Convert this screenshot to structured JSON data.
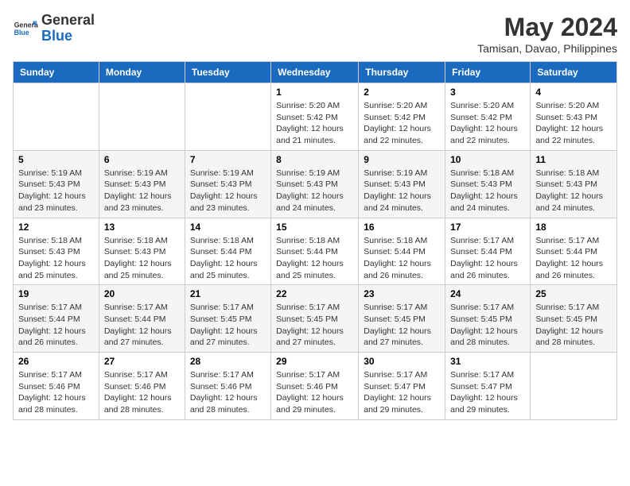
{
  "header": {
    "logo_line1": "General",
    "logo_line2": "Blue",
    "month": "May 2024",
    "location": "Tamisan, Davao, Philippines"
  },
  "weekdays": [
    "Sunday",
    "Monday",
    "Tuesday",
    "Wednesday",
    "Thursday",
    "Friday",
    "Saturday"
  ],
  "weeks": [
    [
      {
        "day": "",
        "info": ""
      },
      {
        "day": "",
        "info": ""
      },
      {
        "day": "",
        "info": ""
      },
      {
        "day": "1",
        "info": "Sunrise: 5:20 AM\nSunset: 5:42 PM\nDaylight: 12 hours\nand 21 minutes."
      },
      {
        "day": "2",
        "info": "Sunrise: 5:20 AM\nSunset: 5:42 PM\nDaylight: 12 hours\nand 22 minutes."
      },
      {
        "day": "3",
        "info": "Sunrise: 5:20 AM\nSunset: 5:42 PM\nDaylight: 12 hours\nand 22 minutes."
      },
      {
        "day": "4",
        "info": "Sunrise: 5:20 AM\nSunset: 5:43 PM\nDaylight: 12 hours\nand 22 minutes."
      }
    ],
    [
      {
        "day": "5",
        "info": "Sunrise: 5:19 AM\nSunset: 5:43 PM\nDaylight: 12 hours\nand 23 minutes."
      },
      {
        "day": "6",
        "info": "Sunrise: 5:19 AM\nSunset: 5:43 PM\nDaylight: 12 hours\nand 23 minutes."
      },
      {
        "day": "7",
        "info": "Sunrise: 5:19 AM\nSunset: 5:43 PM\nDaylight: 12 hours\nand 23 minutes."
      },
      {
        "day": "8",
        "info": "Sunrise: 5:19 AM\nSunset: 5:43 PM\nDaylight: 12 hours\nand 24 minutes."
      },
      {
        "day": "9",
        "info": "Sunrise: 5:19 AM\nSunset: 5:43 PM\nDaylight: 12 hours\nand 24 minutes."
      },
      {
        "day": "10",
        "info": "Sunrise: 5:18 AM\nSunset: 5:43 PM\nDaylight: 12 hours\nand 24 minutes."
      },
      {
        "day": "11",
        "info": "Sunrise: 5:18 AM\nSunset: 5:43 PM\nDaylight: 12 hours\nand 24 minutes."
      }
    ],
    [
      {
        "day": "12",
        "info": "Sunrise: 5:18 AM\nSunset: 5:43 PM\nDaylight: 12 hours\nand 25 minutes."
      },
      {
        "day": "13",
        "info": "Sunrise: 5:18 AM\nSunset: 5:43 PM\nDaylight: 12 hours\nand 25 minutes."
      },
      {
        "day": "14",
        "info": "Sunrise: 5:18 AM\nSunset: 5:44 PM\nDaylight: 12 hours\nand 25 minutes."
      },
      {
        "day": "15",
        "info": "Sunrise: 5:18 AM\nSunset: 5:44 PM\nDaylight: 12 hours\nand 25 minutes."
      },
      {
        "day": "16",
        "info": "Sunrise: 5:18 AM\nSunset: 5:44 PM\nDaylight: 12 hours\nand 26 minutes."
      },
      {
        "day": "17",
        "info": "Sunrise: 5:17 AM\nSunset: 5:44 PM\nDaylight: 12 hours\nand 26 minutes."
      },
      {
        "day": "18",
        "info": "Sunrise: 5:17 AM\nSunset: 5:44 PM\nDaylight: 12 hours\nand 26 minutes."
      }
    ],
    [
      {
        "day": "19",
        "info": "Sunrise: 5:17 AM\nSunset: 5:44 PM\nDaylight: 12 hours\nand 26 minutes."
      },
      {
        "day": "20",
        "info": "Sunrise: 5:17 AM\nSunset: 5:44 PM\nDaylight: 12 hours\nand 27 minutes."
      },
      {
        "day": "21",
        "info": "Sunrise: 5:17 AM\nSunset: 5:45 PM\nDaylight: 12 hours\nand 27 minutes."
      },
      {
        "day": "22",
        "info": "Sunrise: 5:17 AM\nSunset: 5:45 PM\nDaylight: 12 hours\nand 27 minutes."
      },
      {
        "day": "23",
        "info": "Sunrise: 5:17 AM\nSunset: 5:45 PM\nDaylight: 12 hours\nand 27 minutes."
      },
      {
        "day": "24",
        "info": "Sunrise: 5:17 AM\nSunset: 5:45 PM\nDaylight: 12 hours\nand 28 minutes."
      },
      {
        "day": "25",
        "info": "Sunrise: 5:17 AM\nSunset: 5:45 PM\nDaylight: 12 hours\nand 28 minutes."
      }
    ],
    [
      {
        "day": "26",
        "info": "Sunrise: 5:17 AM\nSunset: 5:46 PM\nDaylight: 12 hours\nand 28 minutes."
      },
      {
        "day": "27",
        "info": "Sunrise: 5:17 AM\nSunset: 5:46 PM\nDaylight: 12 hours\nand 28 minutes."
      },
      {
        "day": "28",
        "info": "Sunrise: 5:17 AM\nSunset: 5:46 PM\nDaylight: 12 hours\nand 28 minutes."
      },
      {
        "day": "29",
        "info": "Sunrise: 5:17 AM\nSunset: 5:46 PM\nDaylight: 12 hours\nand 29 minutes."
      },
      {
        "day": "30",
        "info": "Sunrise: 5:17 AM\nSunset: 5:47 PM\nDaylight: 12 hours\nand 29 minutes."
      },
      {
        "day": "31",
        "info": "Sunrise: 5:17 AM\nSunset: 5:47 PM\nDaylight: 12 hours\nand 29 minutes."
      },
      {
        "day": "",
        "info": ""
      }
    ]
  ]
}
